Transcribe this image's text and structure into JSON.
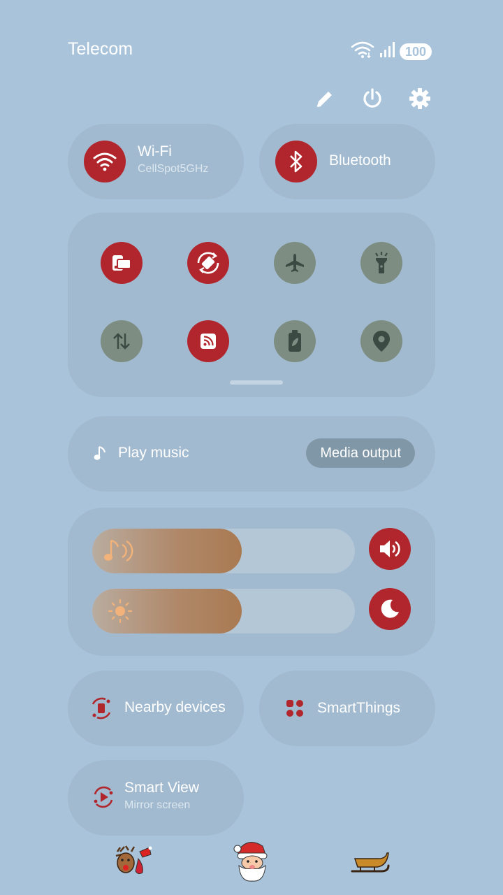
{
  "status_bar": {
    "carrier": "Telecom",
    "battery": "100",
    "icons": [
      "wifi-icon",
      "signal-icon",
      "battery-icon"
    ]
  },
  "top_actions": [
    "edit-icon",
    "power-icon",
    "settings-icon"
  ],
  "tiles": {
    "wifi": {
      "title": "Wi-Fi",
      "subtitle": "CellSpot5GHz",
      "on": true
    },
    "bluetooth": {
      "title": "Bluetooth",
      "on": true
    }
  },
  "quick_toggles": [
    {
      "icon": "screen-share-icon",
      "on": true
    },
    {
      "icon": "auto-rotate-icon",
      "on": true
    },
    {
      "icon": "airplane-icon",
      "on": false
    },
    {
      "icon": "flashlight-icon",
      "on": false
    },
    {
      "icon": "mobile-data-icon",
      "on": false
    },
    {
      "icon": "nfc-icon",
      "on": true
    },
    {
      "icon": "power-saving-icon",
      "on": false
    },
    {
      "icon": "location-icon",
      "on": false
    }
  ],
  "media": {
    "label": "Play music",
    "output_button": "Media output"
  },
  "sliders": {
    "volume": {
      "level": 0.57,
      "icon": "music-volume-icon",
      "side_icon": "speaker-icon"
    },
    "brightness": {
      "level": 0.57,
      "icon": "sun-icon",
      "side_icon": "dark-mode-icon"
    }
  },
  "bottom_tiles": {
    "nearby": {
      "title": "Nearby devices"
    },
    "smartthings": {
      "title": "SmartThings"
    },
    "smartview": {
      "title": "Smart View",
      "subtitle": "Mirror screen"
    }
  },
  "decorations": [
    "reindeer-sticker",
    "santa-sticker",
    "sleigh-sticker"
  ],
  "colors": {
    "background": "#a9c4da",
    "accent_on": "#b1262c",
    "off": "#7d8d82"
  }
}
